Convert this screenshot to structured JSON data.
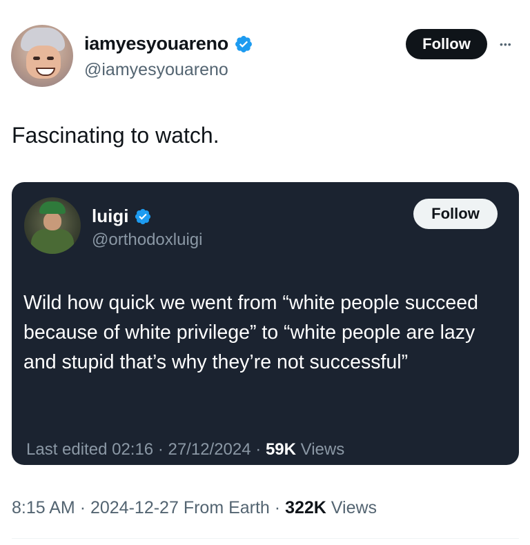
{
  "tweet": {
    "author": {
      "display_name": "iamyesyouareno",
      "handle": "@iamyesyouareno"
    },
    "follow_label": "Follow",
    "more_label": "•••",
    "text": "Fascinating to watch.",
    "time": "8:15 AM",
    "date": "2024-12-27",
    "source": "From Earth",
    "views_count": "322K",
    "views_label": "Views",
    "separator": "·"
  },
  "quote": {
    "author": {
      "display_name": "luigi",
      "handle": "@orthodoxluigi"
    },
    "follow_label": "Follow",
    "text": "Wild how quick we went from “white people succeed because of white privilege” to “white people are lazy and stupid that’s why they’re not successful”",
    "edited": "Last edited 02:16 · 27/12/2024",
    "views_count": "59K",
    "views_label": "Views",
    "separator": "·"
  },
  "colors": {
    "verified": "#1d9bf0",
    "quote_bg": "#1b2330",
    "follow_dark": "#0f1419"
  },
  "icons": {
    "verified": "verified-badge-icon",
    "more": "more-options-icon"
  }
}
